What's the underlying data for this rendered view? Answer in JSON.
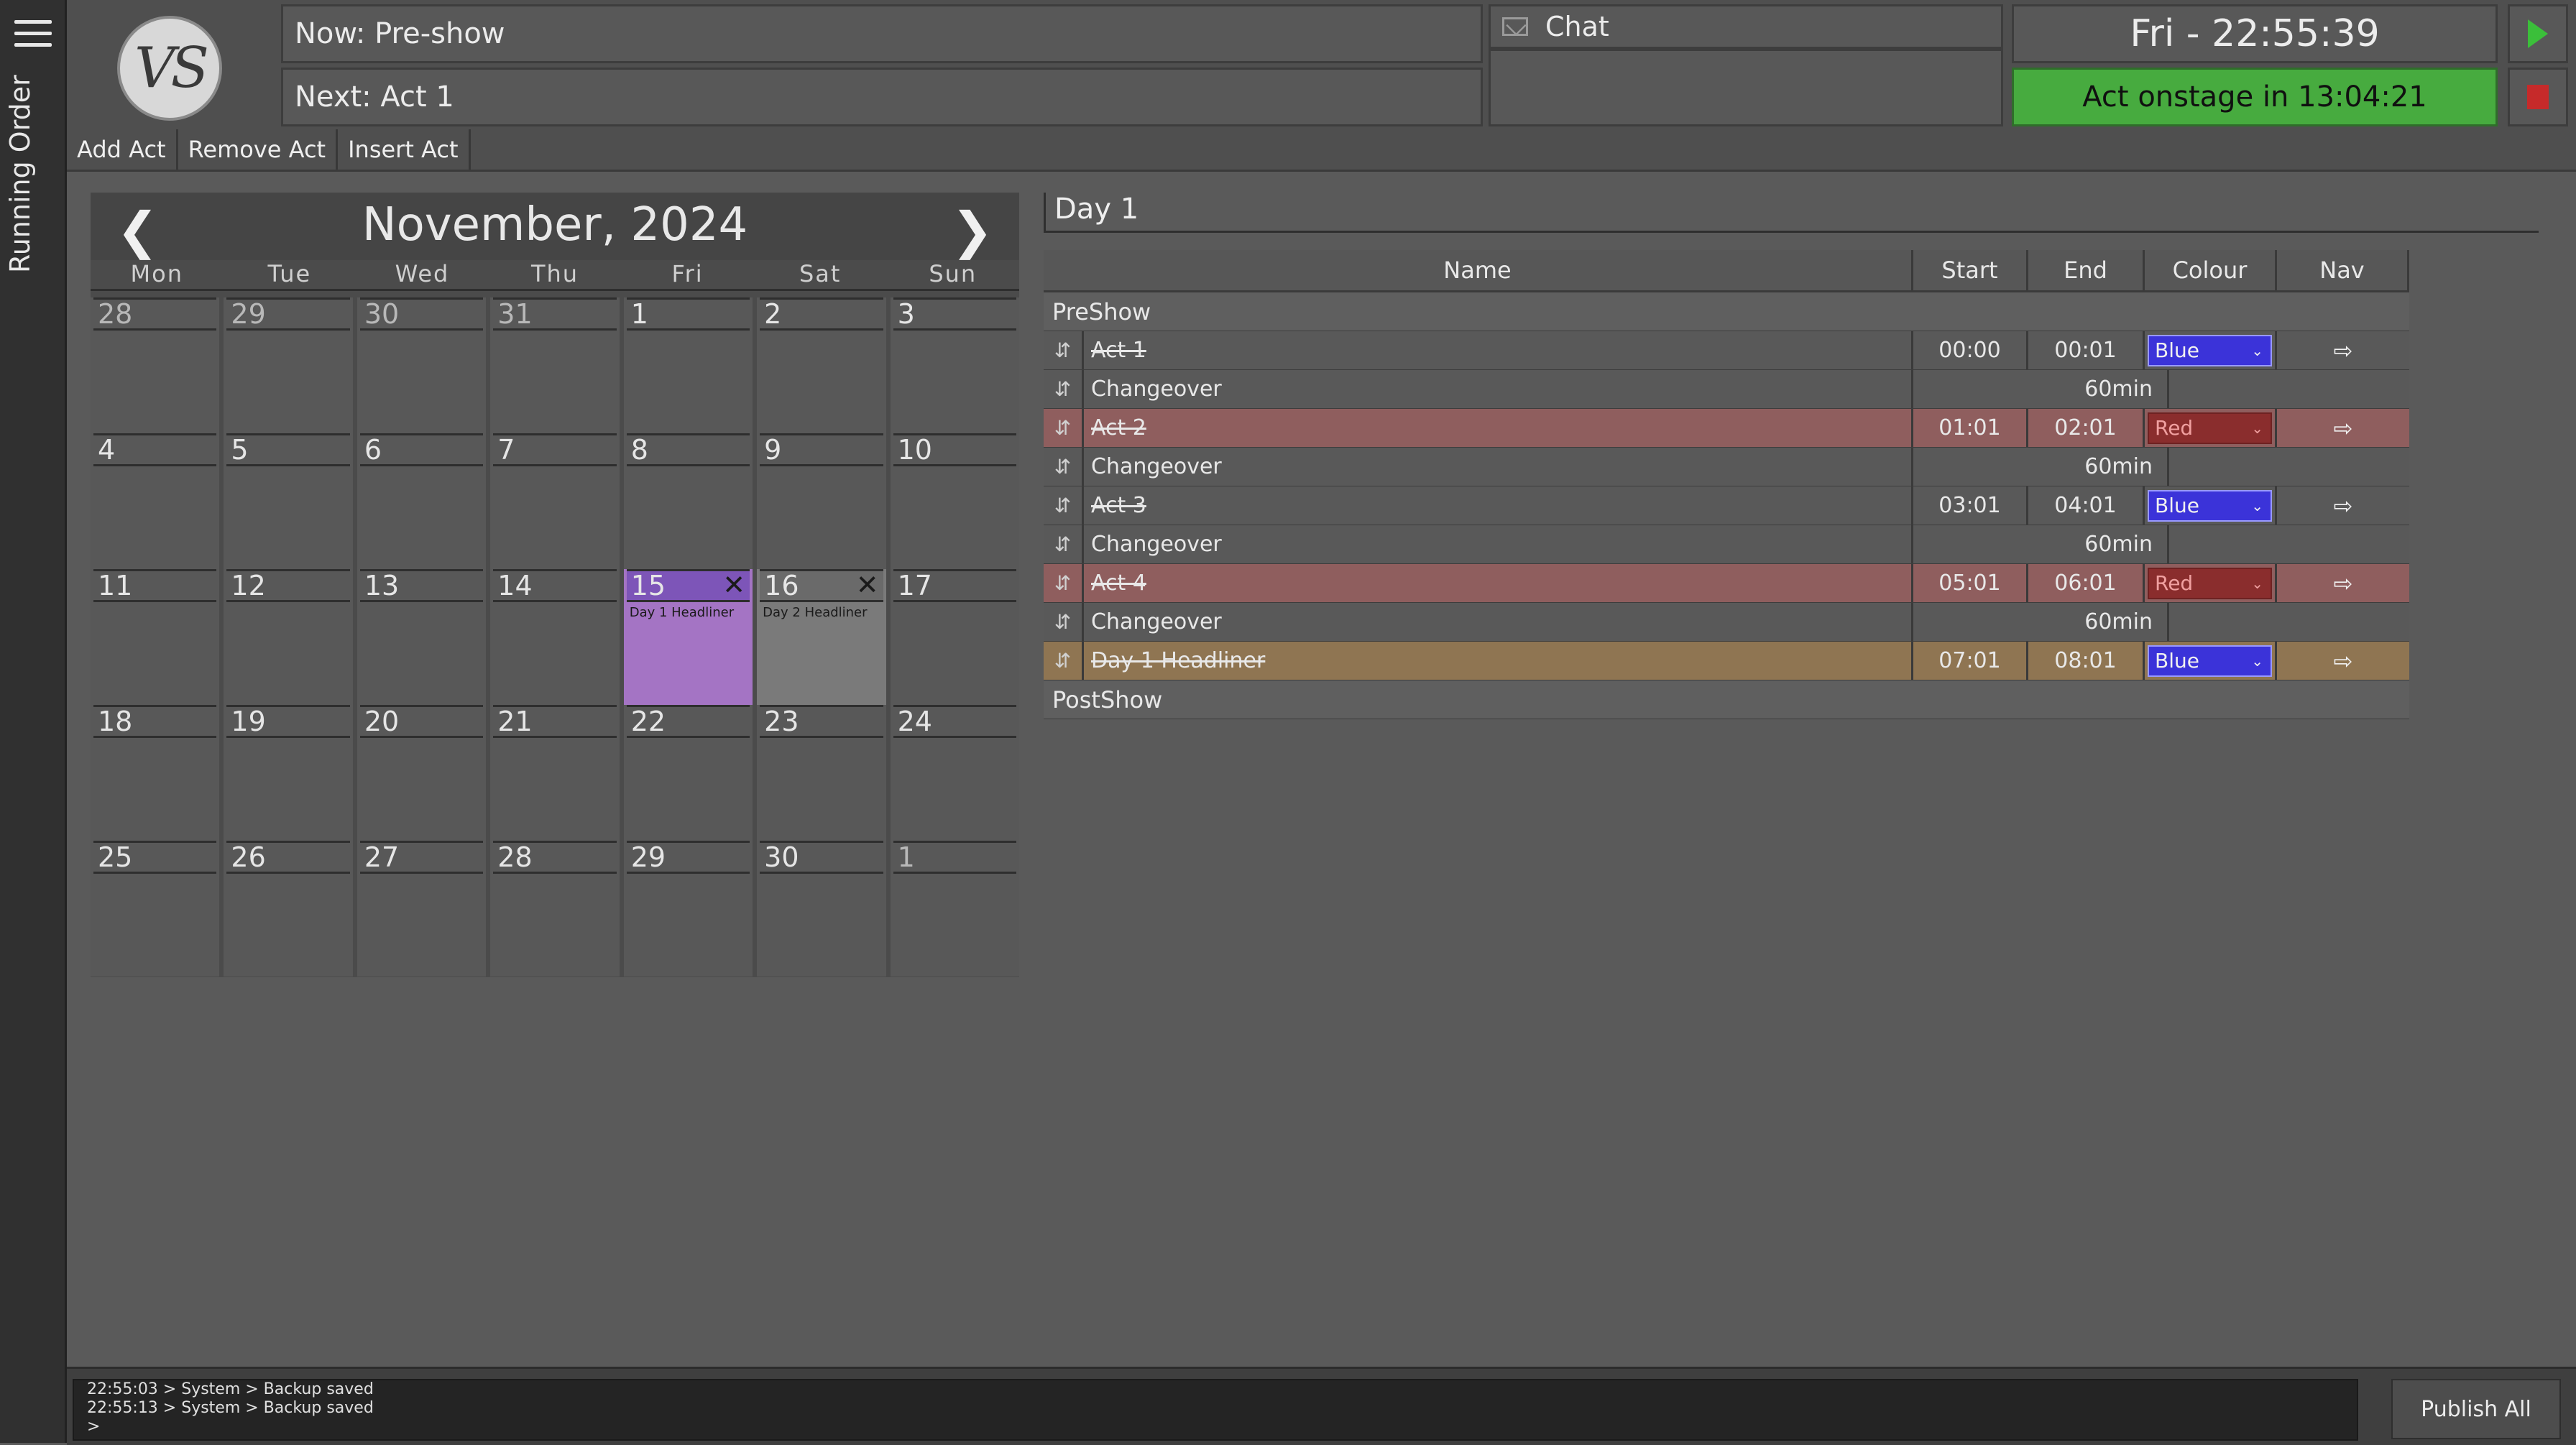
{
  "sidebar": {
    "label": "Running Order"
  },
  "header": {
    "logo_text": "VS",
    "now": "Now: Pre-show",
    "next": "Next: Act 1",
    "chat_label": "Chat",
    "clock": "Fri - 22:55:39",
    "onstage": "Act onstage in 13:04:21",
    "colors": {
      "onstage_bg": "#47ab3f",
      "play": "#3bbf3a",
      "stop": "#c62a2a"
    }
  },
  "toolbar": {
    "add": "Add Act",
    "remove": "Remove Act",
    "insert": "Insert Act"
  },
  "calendar": {
    "title": "November, 2024",
    "prev_icon": "chevron-left-icon",
    "next_icon": "chevron-right-icon",
    "days": [
      "Mon",
      "Tue",
      "Wed",
      "Thu",
      "Fri",
      "Sat",
      "Sun"
    ],
    "cells": [
      {
        "n": "28",
        "other": true
      },
      {
        "n": "29",
        "other": true
      },
      {
        "n": "30",
        "other": true
      },
      {
        "n": "31",
        "other": true
      },
      {
        "n": "1"
      },
      {
        "n": "2"
      },
      {
        "n": "3"
      },
      {
        "n": "4"
      },
      {
        "n": "5"
      },
      {
        "n": "6"
      },
      {
        "n": "7"
      },
      {
        "n": "8"
      },
      {
        "n": "9"
      },
      {
        "n": "10"
      },
      {
        "n": "11"
      },
      {
        "n": "12"
      },
      {
        "n": "13"
      },
      {
        "n": "14"
      },
      {
        "n": "15",
        "event": "Day 1 Headliner",
        "style": "purple"
      },
      {
        "n": "16",
        "event": "Day 2 Headliner",
        "style": "gray"
      },
      {
        "n": "17"
      },
      {
        "n": "18"
      },
      {
        "n": "19"
      },
      {
        "n": "20"
      },
      {
        "n": "21"
      },
      {
        "n": "22"
      },
      {
        "n": "23"
      },
      {
        "n": "24"
      },
      {
        "n": "25"
      },
      {
        "n": "26"
      },
      {
        "n": "27"
      },
      {
        "n": "28"
      },
      {
        "n": "29"
      },
      {
        "n": "30"
      },
      {
        "n": "1",
        "other": true
      }
    ],
    "colors": {
      "event_purple": "#a474c4",
      "event_gray": "#7a7a7a"
    }
  },
  "day": {
    "title": "Day 1",
    "columns": {
      "name": "Name",
      "start": "Start",
      "end": "End",
      "colour": "Colour",
      "nav": "Nav"
    },
    "preshow": "PreShow",
    "postshow": "PostShow",
    "rows": [
      {
        "type": "act",
        "name": "Act 1",
        "start": "00:00",
        "end": "00:01",
        "colour": "Blue",
        "tone": "act"
      },
      {
        "type": "change",
        "name": "Changeover",
        "duration": "60min"
      },
      {
        "type": "act",
        "name": "Act 2",
        "start": "01:01",
        "end": "02:01",
        "colour": "Red",
        "tone": "red"
      },
      {
        "type": "change",
        "name": "Changeover",
        "duration": "60min"
      },
      {
        "type": "act",
        "name": "Act 3",
        "start": "03:01",
        "end": "04:01",
        "colour": "Blue",
        "tone": "act"
      },
      {
        "type": "change",
        "name": "Changeover",
        "duration": "60min"
      },
      {
        "type": "act",
        "name": "Act 4",
        "start": "05:01",
        "end": "06:01",
        "colour": "Red",
        "tone": "red"
      },
      {
        "type": "change",
        "name": "Changeover",
        "duration": "60min"
      },
      {
        "type": "act",
        "name": "Day 1 Headliner",
        "start": "07:01",
        "end": "08:01",
        "colour": "Blue",
        "tone": "gold"
      }
    ]
  },
  "console": {
    "lines": [
      "22:55:03 > System > Backup saved",
      "22:55:13 > System > Backup saved",
      ">"
    ],
    "publish": "Publish All"
  }
}
